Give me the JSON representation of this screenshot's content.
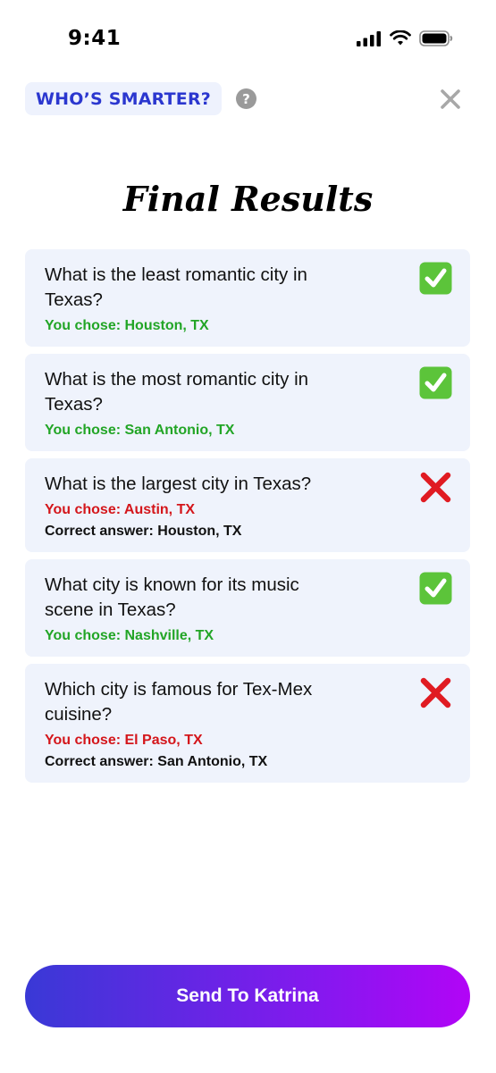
{
  "status_bar": {
    "time": "9:41",
    "icons": [
      "cellular-signal-icon",
      "wifi-icon",
      "battery-icon"
    ]
  },
  "header": {
    "brand": "WHO’S SMARTER?",
    "help_icon": "?",
    "close_icon": "close-icon"
  },
  "title": "Final Results",
  "results": [
    {
      "question": "What is the least romantic city in Texas?",
      "chose": "You chose: Houston, TX",
      "correct": true,
      "correct_answer": ""
    },
    {
      "question": "What is the most romantic city in Texas?",
      "chose": "You chose: San Antonio, TX",
      "correct": true,
      "correct_answer": ""
    },
    {
      "question": "What is the largest city in Texas?",
      "chose": "You chose: Austin, TX",
      "correct": false,
      "correct_answer": "Correct answer: Houston, TX"
    },
    {
      "question": "What city is known for its music scene in Texas?",
      "chose": "You chose: Nashville, TX",
      "correct": true,
      "correct_answer": ""
    },
    {
      "question": "Which city is famous for Tex-Mex cuisine?",
      "chose": "You chose: El Paso, TX",
      "correct": false,
      "correct_answer": "Correct answer: San Antonio, TX"
    }
  ],
  "cta": {
    "label": "Send To Katrina"
  },
  "colors": {
    "brand_blue": "#2b37cf",
    "card_bg": "#eff3fc",
    "correct_green": "#22a526",
    "wrong_red": "#d4161b",
    "check_green": "#5cc43a",
    "cross_red": "#e01b22",
    "cta_start": "#3939d6",
    "cta_end": "#b204f6"
  }
}
